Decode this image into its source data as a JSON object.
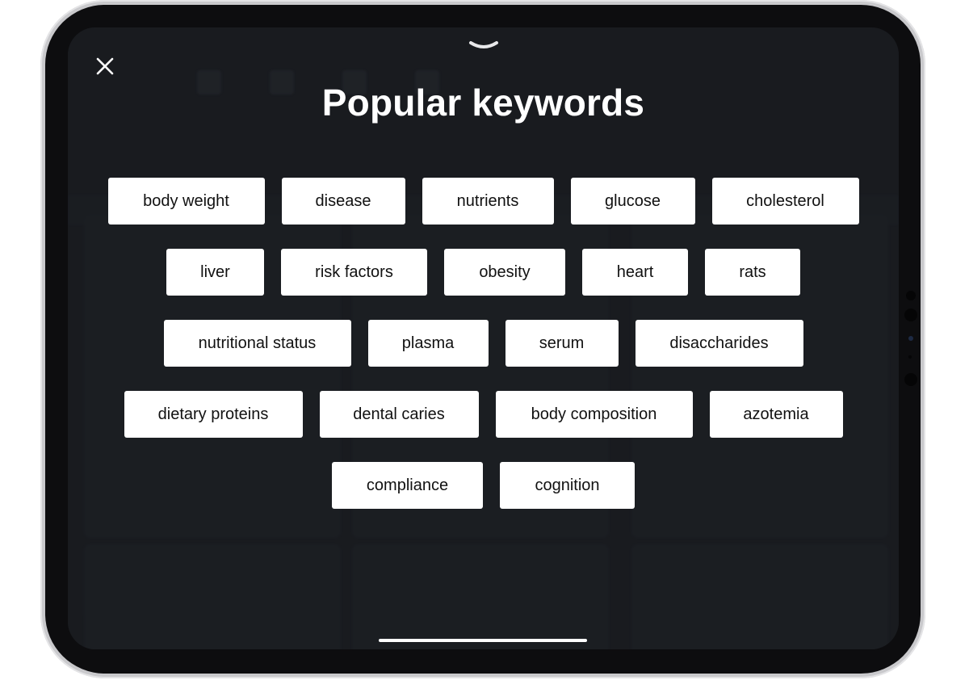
{
  "modal": {
    "title": "Popular keywords",
    "close_icon": "close-icon",
    "grabber_icon": "chevron-down-icon"
  },
  "keyword_rows": [
    [
      "body weight",
      "disease",
      "nutrients",
      "glucose",
      "cholesterol"
    ],
    [
      "liver",
      "risk factors",
      "obesity",
      "heart",
      "rats"
    ],
    [
      "nutritional status",
      "plasma",
      "serum",
      "disaccharides"
    ],
    [
      "dietary proteins",
      "dental caries",
      "body composition",
      "azotemia"
    ],
    [
      "compliance",
      "cognition"
    ]
  ],
  "colors": {
    "screen_background": "#1f2227",
    "chip_background": "#ffffff",
    "chip_text": "#111111",
    "title_text": "#ffffff"
  }
}
